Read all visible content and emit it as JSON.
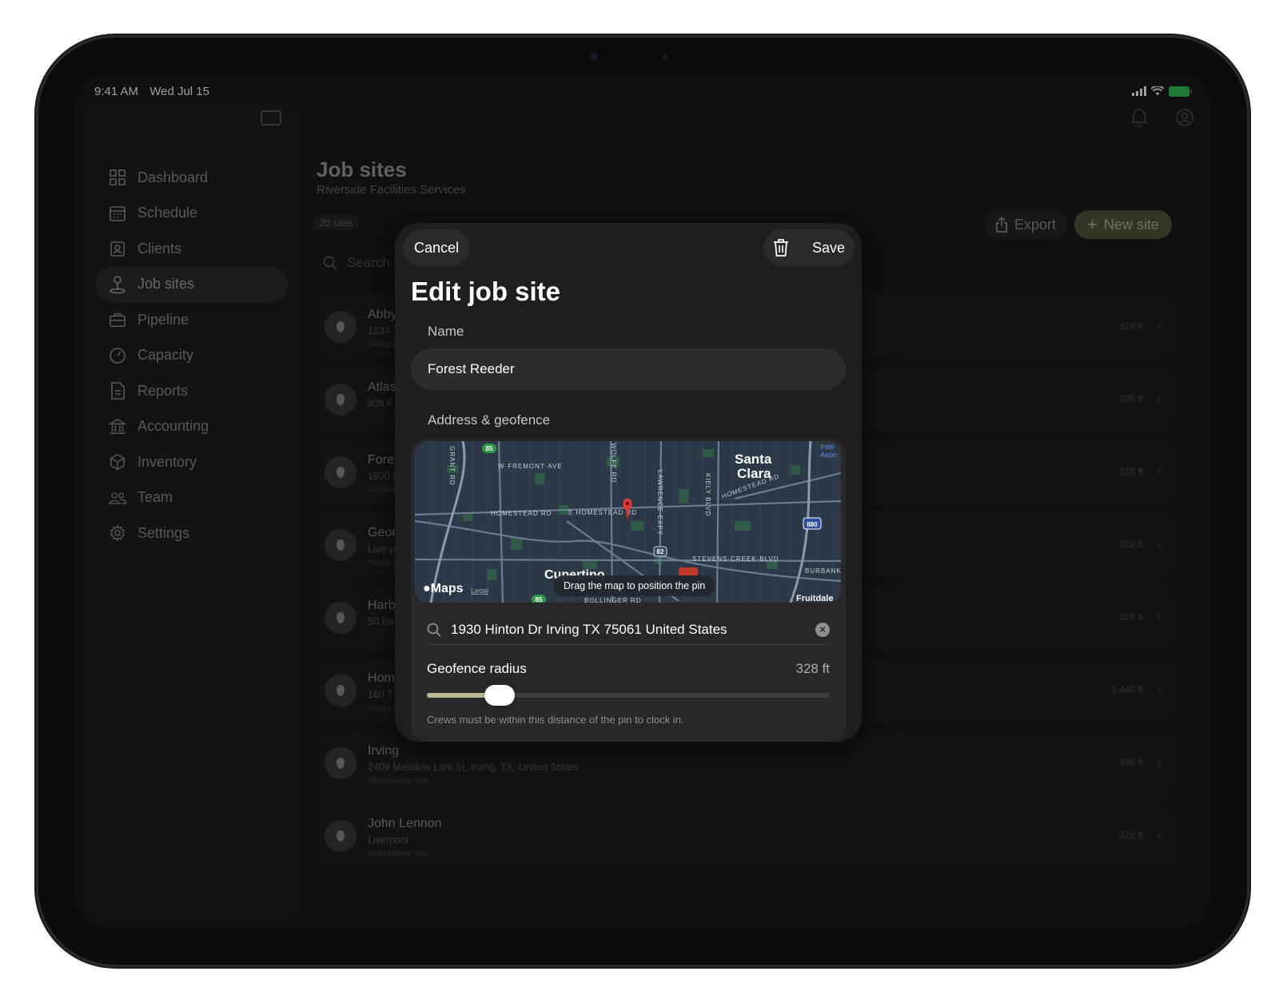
{
  "status_bar": {
    "time": "9:41 AM",
    "date": "Wed Jul 15"
  },
  "sidebar": {
    "items": [
      {
        "label": "Dashboard",
        "icon": "dashboard-icon"
      },
      {
        "label": "Schedule",
        "icon": "calendar-icon"
      },
      {
        "label": "Clients",
        "icon": "contact-card-icon"
      },
      {
        "label": "Job sites",
        "icon": "map-pin-icon",
        "active": true
      },
      {
        "label": "Pipeline",
        "icon": "briefcase-icon"
      },
      {
        "label": "Capacity",
        "icon": "gauge-icon"
      },
      {
        "label": "Reports",
        "icon": "document-icon"
      },
      {
        "label": "Accounting",
        "icon": "bank-icon"
      },
      {
        "label": "Inventory",
        "icon": "box-icon"
      },
      {
        "label": "Team",
        "icon": "people-icon"
      },
      {
        "label": "Settings",
        "icon": "gear-icon"
      }
    ]
  },
  "main": {
    "title": "Job sites",
    "subtitle": "Riverside Facilities Services",
    "count": "20 sites",
    "export_label": "Export",
    "new_label": "New site",
    "search_placeholder": "Search s",
    "sites": [
      {
        "name": "Abby",
        "address": "1234",
        "type": "Standa",
        "radius": "328 ft"
      },
      {
        "name": "Atlas",
        "address": "808 F",
        "type": "",
        "radius": "328 ft"
      },
      {
        "name": "Fores",
        "address": "1930 I",
        "type": "Standa",
        "radius": "328 ft"
      },
      {
        "name": "Geor",
        "address": "Liverp",
        "type": "Standa",
        "radius": "328 ft"
      },
      {
        "name": "Harb",
        "address": "50 Ba",
        "type": "",
        "radius": "328 ft"
      },
      {
        "name": "Hom",
        "address": "160 T",
        "type": "Standa",
        "radius": "1,440 ft"
      },
      {
        "name": "Irving",
        "address": "2409 Meadow Lark St, Irving, TX, United States",
        "type": "Standalone site",
        "radius": "499 ft"
      },
      {
        "name": "John Lennon",
        "address": "Liverpool",
        "type": "Standalone site",
        "radius": "328 ft"
      }
    ]
  },
  "modal": {
    "cancel_label": "Cancel",
    "save_label": "Save",
    "title": "Edit job site",
    "name_label": "Name",
    "name_value": "Forest  Reeder",
    "address_label": "Address & geofence",
    "map": {
      "hint": "Drag the map to position the pin",
      "brand": "Maps",
      "legal": "Legal",
      "labels": [
        "W FREMONT AVE",
        "HOMESTEAD RD",
        "E HOMESTEAD RD",
        "Santa",
        "Clara",
        "HOMESTEAD RD",
        "STEVENS CREEK BLVD",
        "Cupertino",
        "BURBANK",
        "Fruitdale",
        "Inter",
        "Airpo",
        "GRANT RD",
        "WOLFE RD",
        "LAWRENCE EXPY",
        "KIELY BLVD",
        "BOLLINGER RD"
      ],
      "shields": [
        "85",
        "82",
        "880",
        "85",
        "82"
      ]
    },
    "address_value": "1930 Hinton Dr Irving TX 75061 United States",
    "radius_label": "Geofence radius",
    "radius_value": "328 ft",
    "radius_fraction": 0.18,
    "radius_hint": "Crews must be within this distance of the pin to clock in."
  }
}
